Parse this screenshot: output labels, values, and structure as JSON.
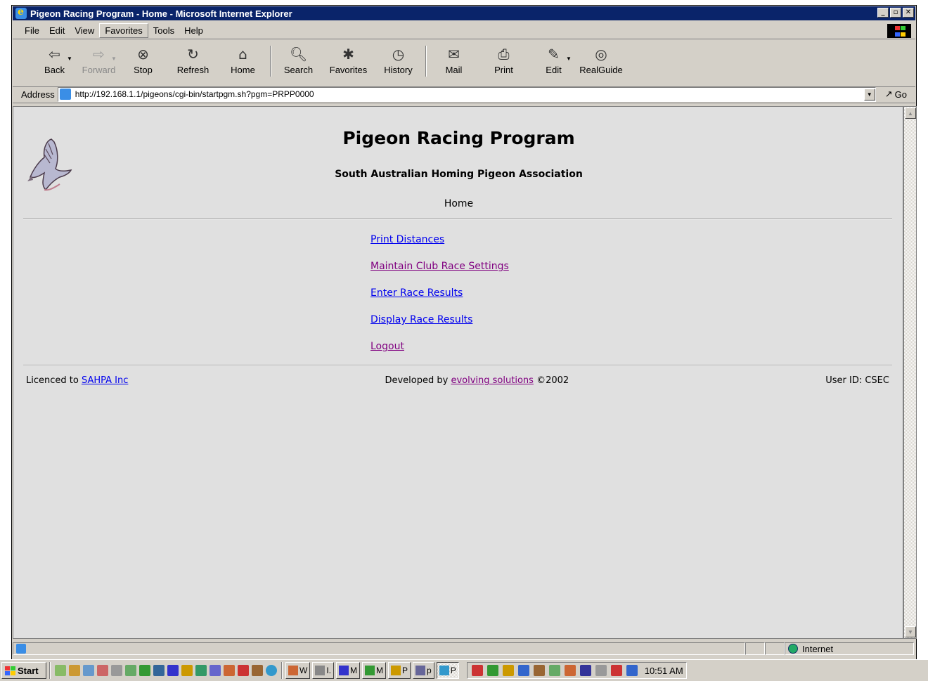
{
  "window": {
    "title": "Pigeon Racing Program - Home - Microsoft Internet Explorer",
    "controls": [
      "_",
      "▫",
      "✕"
    ]
  },
  "menu": {
    "items": [
      "File",
      "Edit",
      "View",
      "Favorites",
      "Tools",
      "Help"
    ]
  },
  "toolbar": {
    "back": "Back",
    "forward": "Forward",
    "stop": "Stop",
    "refresh": "Refresh",
    "home": "Home",
    "search": "Search",
    "favorites": "Favorites",
    "history": "History",
    "mail": "Mail",
    "print": "Print",
    "edit": "Edit",
    "realguide": "RealGuide"
  },
  "address": {
    "label": "Address",
    "url": "http://192.168.1.1/pigeons/cgi-bin/startpgm.sh?pgm=PRPP0000",
    "go": "Go"
  },
  "page": {
    "title": "Pigeon Racing Program",
    "subtitle": "South Australian Homing Pigeon Association",
    "section": "Home",
    "links": [
      {
        "label": "Print Distances",
        "visited": false
      },
      {
        "label": "Maintain Club Race Settings",
        "visited": true
      },
      {
        "label": "Enter Race Results",
        "visited": false
      },
      {
        "label": "Display Race Results",
        "visited": false
      },
      {
        "label": "Logout",
        "visited": true
      }
    ],
    "footer": {
      "licenced_prefix": "Licenced to",
      "licenced_link": "SAHPA Inc",
      "developed_prefix": "Developed by",
      "developed_link": "evolving solutions",
      "developed_suffix": "©2002",
      "user_id": "User ID: CSEC"
    }
  },
  "status": {
    "zone": "Internet"
  },
  "taskbar": {
    "start": "Start",
    "tasks": [
      "W",
      "I.",
      "M",
      "M",
      "P",
      "p",
      "P"
    ],
    "clock": "10:51 AM"
  },
  "colors": {
    "titlebar": "#0a246a",
    "chrome": "#d4d0c8",
    "page_bg": "#e0e0e0",
    "link": "#0000ee",
    "visited": "#800080"
  }
}
